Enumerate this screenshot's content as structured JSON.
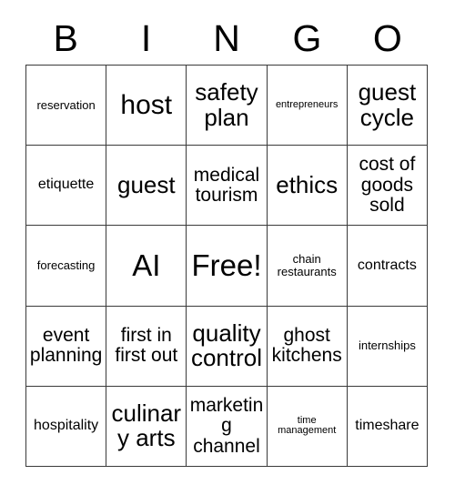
{
  "card": {
    "title": "BINGO",
    "header_letters": [
      "B",
      "I",
      "N",
      "G",
      "O"
    ],
    "columns": 5,
    "rows": 5,
    "free_space_label": "Free!",
    "free_space_position": "center",
    "colors": {
      "background": "#ffffff",
      "text": "#000000",
      "grid_line": "#3a3a3a"
    },
    "cells": [
      [
        {
          "text": "reservation",
          "size": "xs"
        },
        {
          "text": "host",
          "size": "xl"
        },
        {
          "text": "safety plan",
          "size": "lg"
        },
        {
          "text": "entrepreneurs",
          "size": "xxs"
        },
        {
          "text": "guest cycle",
          "size": "lg"
        }
      ],
      [
        {
          "text": "etiquette",
          "size": "sm"
        },
        {
          "text": "guest",
          "size": "lg"
        },
        {
          "text": "medical tourism",
          "size": "md"
        },
        {
          "text": "ethics",
          "size": "lg"
        },
        {
          "text": "cost of goods sold",
          "size": "md"
        }
      ],
      [
        {
          "text": "forecasting",
          "size": "xs"
        },
        {
          "text": "AI",
          "size": "xxl"
        },
        {
          "text": "Free!",
          "size": "xxl"
        },
        {
          "text": "chain restaurants",
          "size": "xs"
        },
        {
          "text": "contracts",
          "size": "sm"
        }
      ],
      [
        {
          "text": "event planning",
          "size": "md"
        },
        {
          "text": "first in first out",
          "size": "md"
        },
        {
          "text": "quality control",
          "size": "lg"
        },
        {
          "text": "ghost kitchens",
          "size": "md"
        },
        {
          "text": "internships",
          "size": "xs"
        }
      ],
      [
        {
          "text": "hospitality",
          "size": "sm"
        },
        {
          "text": "culinary arts",
          "size": "lg"
        },
        {
          "text": "marketing channel",
          "size": "md"
        },
        {
          "text": "time management",
          "size": "xxs"
        },
        {
          "text": "timeshare",
          "size": "sm"
        }
      ]
    ]
  }
}
